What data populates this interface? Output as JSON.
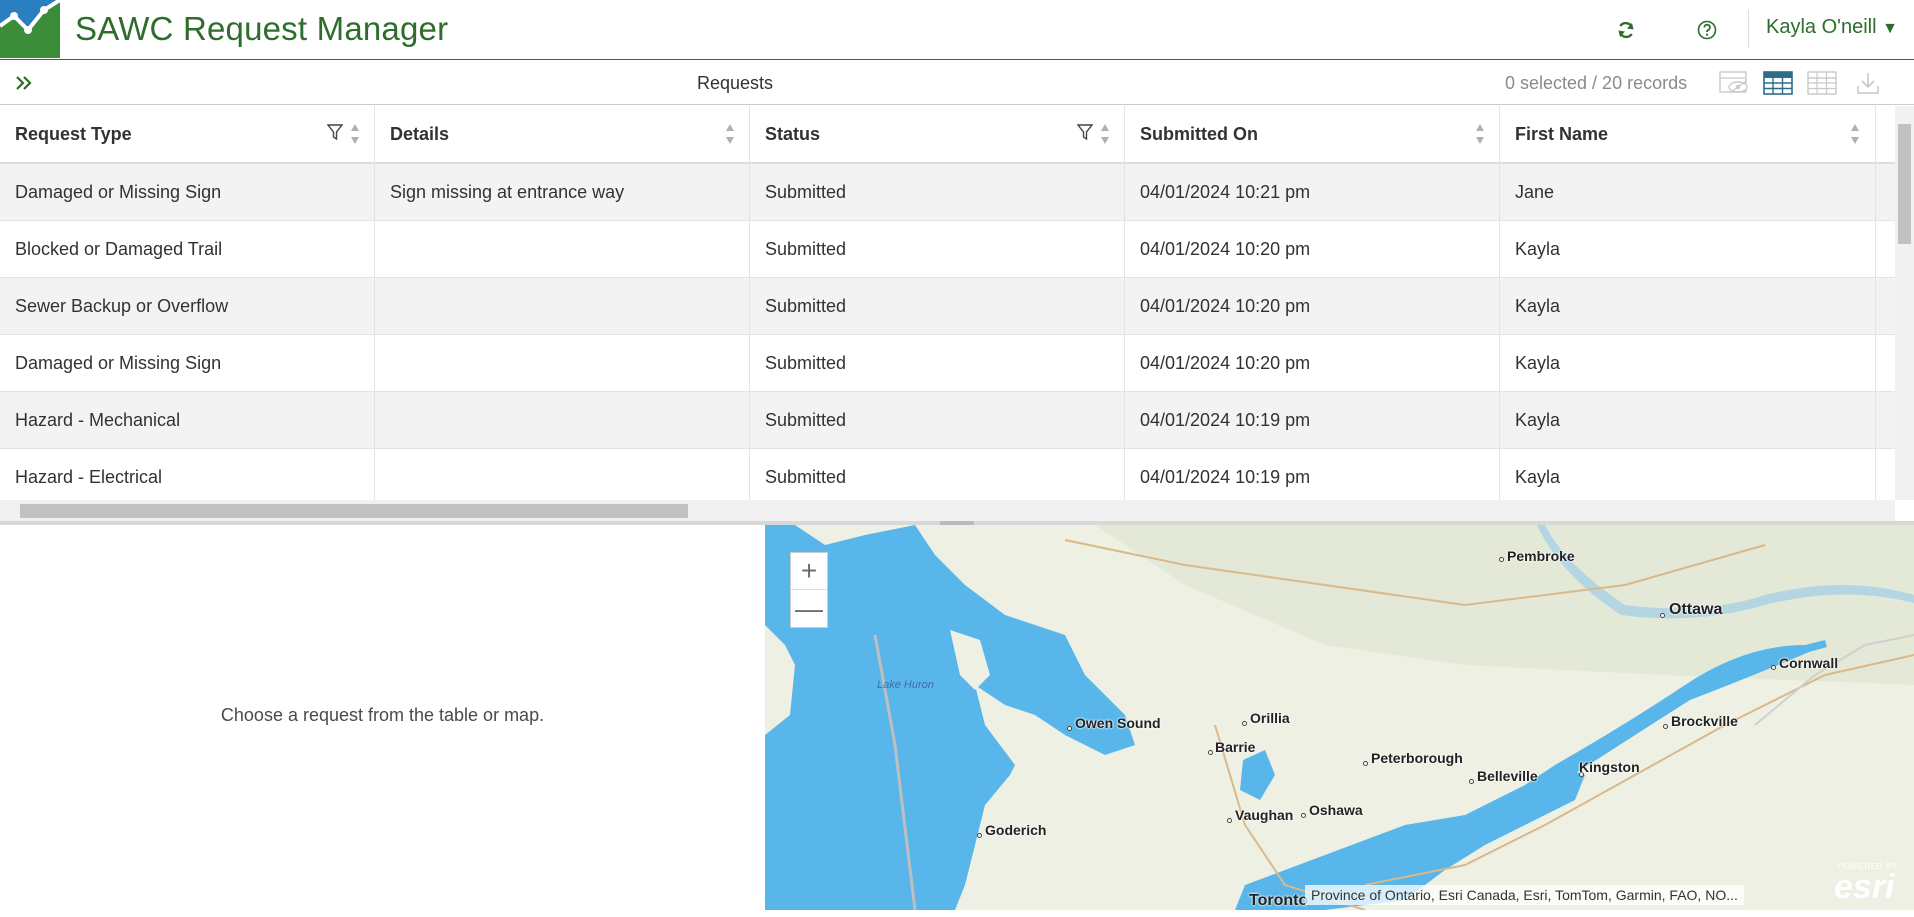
{
  "app": {
    "title": "SAWC Request Manager",
    "user_name": "Kayla O'neill",
    "brand_color": "#2e6d2c",
    "icons": [
      "refresh-icon",
      "help-icon",
      "caret-down-icon"
    ]
  },
  "table_toolbar": {
    "title": "Requests",
    "selection_count": "0 selected / 20 records",
    "icons": [
      "expand-icon",
      "show-selected-icon",
      "table-icon",
      "table-options-icon",
      "download-icon"
    ]
  },
  "table": {
    "columns": [
      {
        "label": "Request Type",
        "filterable": true
      },
      {
        "label": "Details",
        "filterable": false
      },
      {
        "label": "Status",
        "filterable": true
      },
      {
        "label": "Submitted On",
        "filterable": false
      },
      {
        "label": "First Name",
        "filterable": false
      }
    ],
    "rows": [
      {
        "request_type": "Damaged or Missing Sign",
        "details": "Sign missing at entrance way",
        "status": "Submitted",
        "submitted_on": "04/01/2024 10:21 pm",
        "first_name": "Jane"
      },
      {
        "request_type": "Blocked or Damaged Trail",
        "details": "",
        "status": "Submitted",
        "submitted_on": "04/01/2024 10:20 pm",
        "first_name": "Kayla"
      },
      {
        "request_type": "Sewer Backup or Overflow",
        "details": "",
        "status": "Submitted",
        "submitted_on": "04/01/2024 10:20 pm",
        "first_name": "Kayla"
      },
      {
        "request_type": "Damaged or Missing Sign",
        "details": "",
        "status": "Submitted",
        "submitted_on": "04/01/2024 10:20 pm",
        "first_name": "Kayla"
      },
      {
        "request_type": "Hazard - Mechanical",
        "details": "",
        "status": "Submitted",
        "submitted_on": "04/01/2024 10:19 pm",
        "first_name": "Kayla"
      },
      {
        "request_type": "Hazard - Electrical",
        "details": "",
        "status": "Submitted",
        "submitted_on": "04/01/2024 10:19 pm",
        "first_name": "Kayla"
      }
    ]
  },
  "details_panel": {
    "message": "Choose a request from the table or map."
  },
  "map": {
    "zoom_in": "+",
    "zoom_out": "—",
    "lake_label": "Lake Huron",
    "cities": {
      "pembroke": "Pembroke",
      "ottawa": "Ottawa",
      "cornwall": "Cornwall",
      "orillia": "Orillia",
      "owen_sound": "Owen Sound",
      "barrie": "Barrie",
      "brockville": "Brockville",
      "peterborough": "Peterborough",
      "kingston": "Kingston",
      "belleville": "Belleville",
      "vaughan": "Vaughan",
      "oshawa": "Oshawa",
      "goderich": "Goderich",
      "toronto": "Toronto"
    },
    "attribution": "Province of Ontario, Esri Canada, Esri, TomTom, Garmin, FAO, NO...",
    "esri_small": "POWERED BY",
    "esri_big": "esri",
    "water_color": "#59b6ea",
    "land_color": "#eef0e4"
  }
}
